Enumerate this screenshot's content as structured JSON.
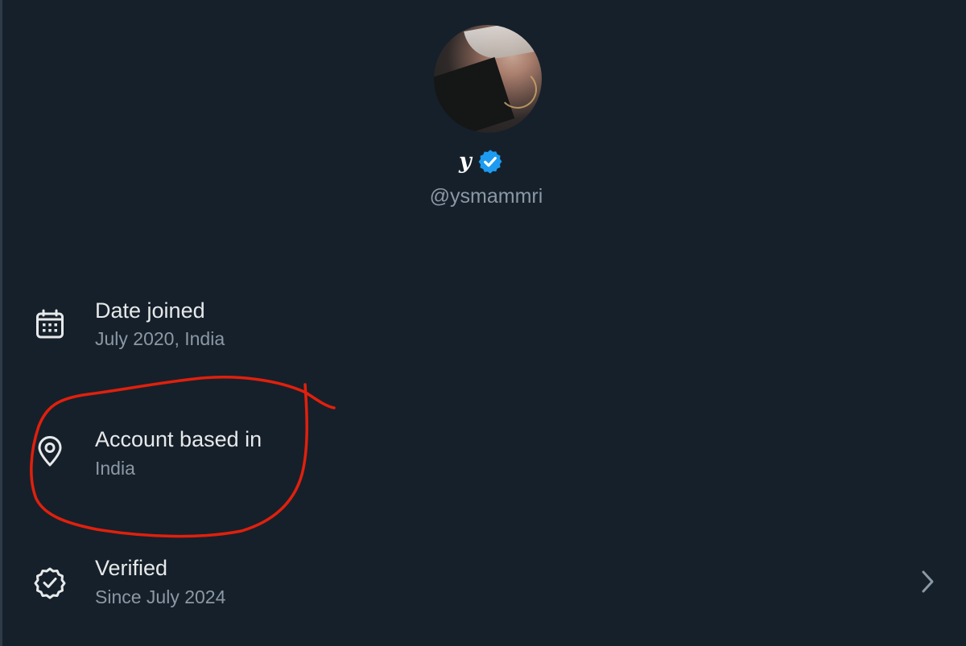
{
  "profile": {
    "display_name": "y",
    "handle": "@ysmammri",
    "verified": true
  },
  "about": {
    "items": [
      {
        "icon": "calendar-icon",
        "title": "Date joined",
        "subtitle": "July 2020, India"
      },
      {
        "icon": "location-pin-icon",
        "title": "Account based in",
        "subtitle": "India"
      },
      {
        "icon": "verified-check-icon",
        "title": "Verified",
        "subtitle": "Since July 2024"
      }
    ]
  },
  "colors": {
    "background": "#16202a",
    "primary_text": "#e7e9ea",
    "secondary_text": "#8b98a5",
    "verified_blue": "#1d9bf0",
    "annotation_red": "#e0200d"
  }
}
